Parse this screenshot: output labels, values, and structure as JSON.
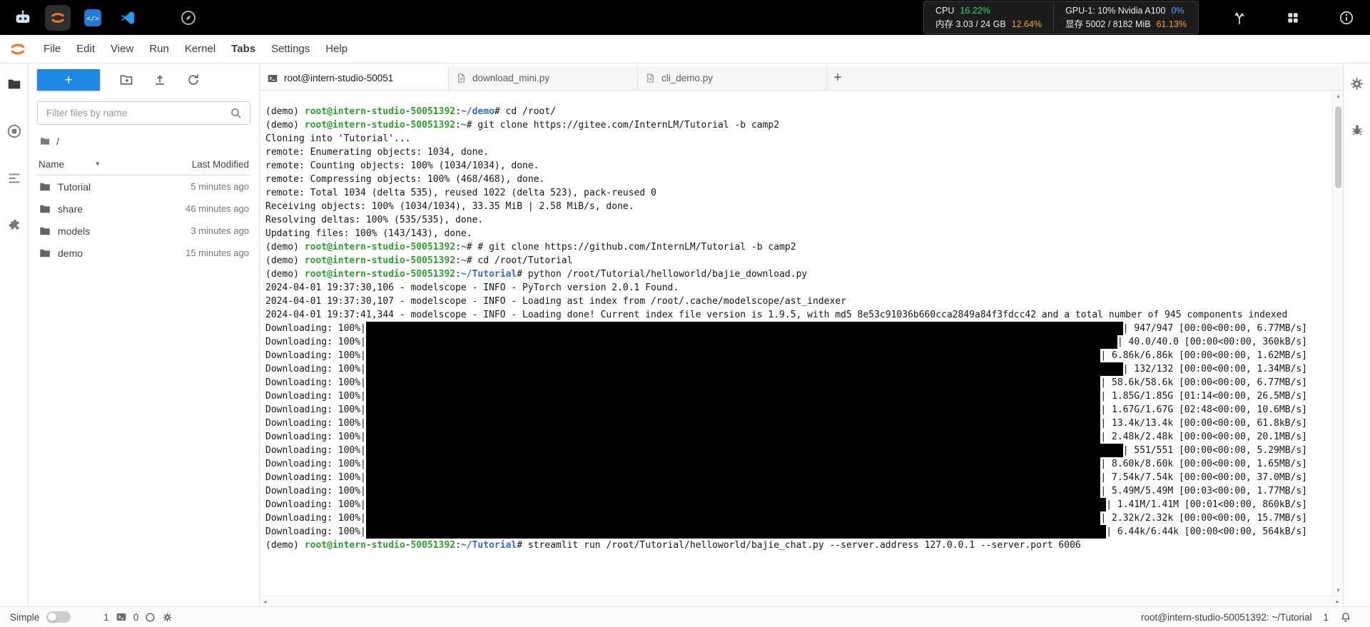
{
  "colors": {
    "topbar_bg": "#000000",
    "accent_blue": "#1e88e5",
    "terminal_green": "#2aa22a",
    "terminal_blue": "#2d6bd2",
    "stat_green": "#2bd96a",
    "stat_orange": "#f5a623",
    "stat_blue": "#46a6ff",
    "redacted": "#000000"
  },
  "glyphs": {
    "plus": "+",
    "close": "×",
    "caret_down": "▾",
    "arrow_up": "▴",
    "arrow_down": "▾",
    "arrow_left": "◂",
    "arrow_right": "▸"
  },
  "topbar": {
    "stats": {
      "cpu_label": "CPU",
      "cpu_value": "16.22%",
      "mem_label": "内存 3.03 / 24 GB",
      "mem_value": "12.64%",
      "gpu_label": "GPU-1: 10% Nvidia A100",
      "gpu_value": "0%",
      "vram_label": "显存 5002 / 8182 MiB",
      "vram_value": "61.13%"
    }
  },
  "menu": {
    "items": [
      {
        "label": "File",
        "active": false
      },
      {
        "label": "Edit",
        "active": false
      },
      {
        "label": "View",
        "active": false
      },
      {
        "label": "Run",
        "active": false
      },
      {
        "label": "Kernel",
        "active": false
      },
      {
        "label": "Tabs",
        "active": true
      },
      {
        "label": "Settings",
        "active": false
      },
      {
        "label": "Help",
        "active": false
      }
    ]
  },
  "filebrowser": {
    "filter_placeholder": "Filter files by name",
    "breadcrumb": "/",
    "columns": {
      "name": "Name",
      "modified": "Last Modified"
    },
    "rows": [
      {
        "name": "Tutorial",
        "modified": "5 minutes ago"
      },
      {
        "name": "share",
        "modified": "46 minutes ago"
      },
      {
        "name": "models",
        "modified": "3 minutes ago"
      },
      {
        "name": "demo",
        "modified": "15 minutes ago"
      }
    ]
  },
  "tabs": [
    {
      "label": "root@intern-studio-50051",
      "icon": "terminal-icon",
      "active": true
    },
    {
      "label": "download_mini.py",
      "icon": "file-icon",
      "active": false
    },
    {
      "label": "cli_demo.py",
      "icon": "file-icon",
      "active": false
    }
  ],
  "terminal": {
    "lines": [
      {
        "s": [
          [
            "d",
            "(demo) "
          ],
          [
            "g",
            "root@intern-studio-50051392"
          ],
          [
            "d",
            ":"
          ],
          [
            "b",
            "~/demo"
          ],
          [
            "d",
            "# cd /root/"
          ]
        ]
      },
      {
        "s": [
          [
            "d",
            "(demo) "
          ],
          [
            "g",
            "root@intern-studio-50051392"
          ],
          [
            "d",
            ":"
          ],
          [
            "b",
            "~"
          ],
          [
            "d",
            "# git clone https://gitee.com/InternLM/Tutorial -b camp2"
          ]
        ]
      },
      {
        "s": [
          [
            "d",
            "Cloning into 'Tutorial'..."
          ]
        ]
      },
      {
        "s": [
          [
            "d",
            "remote: Enumerating objects: 1034, done."
          ]
        ]
      },
      {
        "s": [
          [
            "d",
            "remote: Counting objects: 100% (1034/1034), done."
          ]
        ]
      },
      {
        "s": [
          [
            "d",
            "remote: Compressing objects: 100% (468/468), done."
          ]
        ]
      },
      {
        "s": [
          [
            "d",
            "remote: Total 1034 (delta 535), reused 1022 (delta 523), pack-reused 0"
          ]
        ]
      },
      {
        "s": [
          [
            "d",
            "Receiving objects: 100% (1034/1034), 33.35 MiB | 2.58 MiB/s, done."
          ]
        ]
      },
      {
        "s": [
          [
            "d",
            "Resolving deltas: 100% (535/535), done."
          ]
        ]
      },
      {
        "s": [
          [
            "d",
            "Updating files: 100% (143/143), done."
          ]
        ]
      },
      {
        "s": [
          [
            "d",
            "(demo) "
          ],
          [
            "g",
            "root@intern-studio-50051392"
          ],
          [
            "d",
            ":"
          ],
          [
            "b",
            "~"
          ],
          [
            "d",
            "# # git clone https://github.com/InternLM/Tutorial -b camp2"
          ]
        ]
      },
      {
        "s": [
          [
            "d",
            "(demo) "
          ],
          [
            "g",
            "root@intern-studio-50051392"
          ],
          [
            "d",
            ":"
          ],
          [
            "b",
            "~"
          ],
          [
            "d",
            "# cd /root/Tutorial"
          ]
        ]
      },
      {
        "s": [
          [
            "d",
            "(demo) "
          ],
          [
            "g",
            "root@intern-studio-50051392"
          ],
          [
            "d",
            ":"
          ],
          [
            "b",
            "~/Tutorial"
          ],
          [
            "d",
            "# python /root/Tutorial/helloworld/bajie_download.py"
          ]
        ]
      },
      {
        "s": [
          [
            "d",
            "2024-04-01 19:37:30,106 - modelscope - INFO - PyTorch version 2.0.1 Found."
          ]
        ]
      },
      {
        "s": [
          [
            "d",
            "2024-04-01 19:37:30,107 - modelscope - INFO - Loading ast index from /root/.cache/modelscope/ast_indexer"
          ]
        ]
      },
      {
        "s": [
          [
            "d",
            "2024-04-01 19:37:41,344 - modelscope - INFO - Loading done! Current index file version is 1.9.5, with md5 8e53c91036b660cca2849a84f3fdcc42 and a total number of 945 components indexed"
          ]
        ]
      },
      {
        "p": true,
        "prefix": "Downloading: 100%|",
        "suffix": "| 947/947 [00:00<00:00, 6.77MB/s]"
      },
      {
        "p": true,
        "prefix": "Downloading: 100%|",
        "suffix": "| 40.0/40.0 [00:00<00:00, 360kB/s]"
      },
      {
        "p": true,
        "prefix": "Downloading: 100%|",
        "suffix": "| 6.86k/6.86k [00:00<00:00, 1.62MB/s]"
      },
      {
        "p": true,
        "prefix": "Downloading: 100%|",
        "suffix": "| 132/132 [00:00<00:00, 1.34MB/s]"
      },
      {
        "p": true,
        "prefix": "Downloading: 100%|",
        "suffix": "| 58.6k/58.6k [00:00<00:00, 6.77MB/s]"
      },
      {
        "p": true,
        "prefix": "Downloading: 100%|",
        "suffix": "| 1.85G/1.85G [01:14<00:00, 26.5MB/s]"
      },
      {
        "p": true,
        "prefix": "Downloading: 100%|",
        "suffix": "| 1.67G/1.67G [02:48<00:00, 10.6MB/s]"
      },
      {
        "p": true,
        "prefix": "Downloading: 100%|",
        "suffix": "| 13.4k/13.4k [00:00<00:00, 61.8kB/s]"
      },
      {
        "p": true,
        "prefix": "Downloading: 100%|",
        "suffix": "| 2.48k/2.48k [00:00<00:00, 20.1MB/s]"
      },
      {
        "p": true,
        "prefix": "Downloading: 100%|",
        "suffix": "| 551/551 [00:00<00:00, 5.29MB/s]"
      },
      {
        "p": true,
        "prefix": "Downloading: 100%|",
        "suffix": "| 8.60k/8.60k [00:00<00:00, 1.65MB/s]"
      },
      {
        "p": true,
        "prefix": "Downloading: 100%|",
        "suffix": "| 7.54k/7.54k [00:00<00:00, 37.0MB/s]"
      },
      {
        "p": true,
        "prefix": "Downloading: 100%|",
        "suffix": "| 5.49M/5.49M [00:03<00:00, 1.77MB/s]"
      },
      {
        "p": true,
        "prefix": "Downloading: 100%|",
        "suffix": "| 1.41M/1.41M [00:01<00:00, 860kB/s]"
      },
      {
        "p": true,
        "prefix": "Downloading: 100%|",
        "suffix": "| 2.32k/2.32k [00:00<00:00, 15.7MB/s]"
      },
      {
        "p": true,
        "prefix": "Downloading: 100%|",
        "suffix": "| 6.44k/6.44k [00:00<00:00, 564kB/s]"
      },
      {
        "s": [
          [
            "d",
            "(demo) "
          ],
          [
            "g",
            "root@intern-studio-50051392"
          ],
          [
            "d",
            ":"
          ],
          [
            "b",
            "~/Tutorial"
          ],
          [
            "d",
            "# streamlit run /root/Tutorial/helloworld/bajie_chat.py --server.address 127.0.0.1 --server.port 6006"
          ]
        ]
      }
    ]
  },
  "statusbar": {
    "mode": "Simple",
    "terminals_count": "1",
    "kernels_count": "0",
    "session": "root@intern-studio-50051392: ~/Tutorial",
    "notifications_count": "1"
  }
}
